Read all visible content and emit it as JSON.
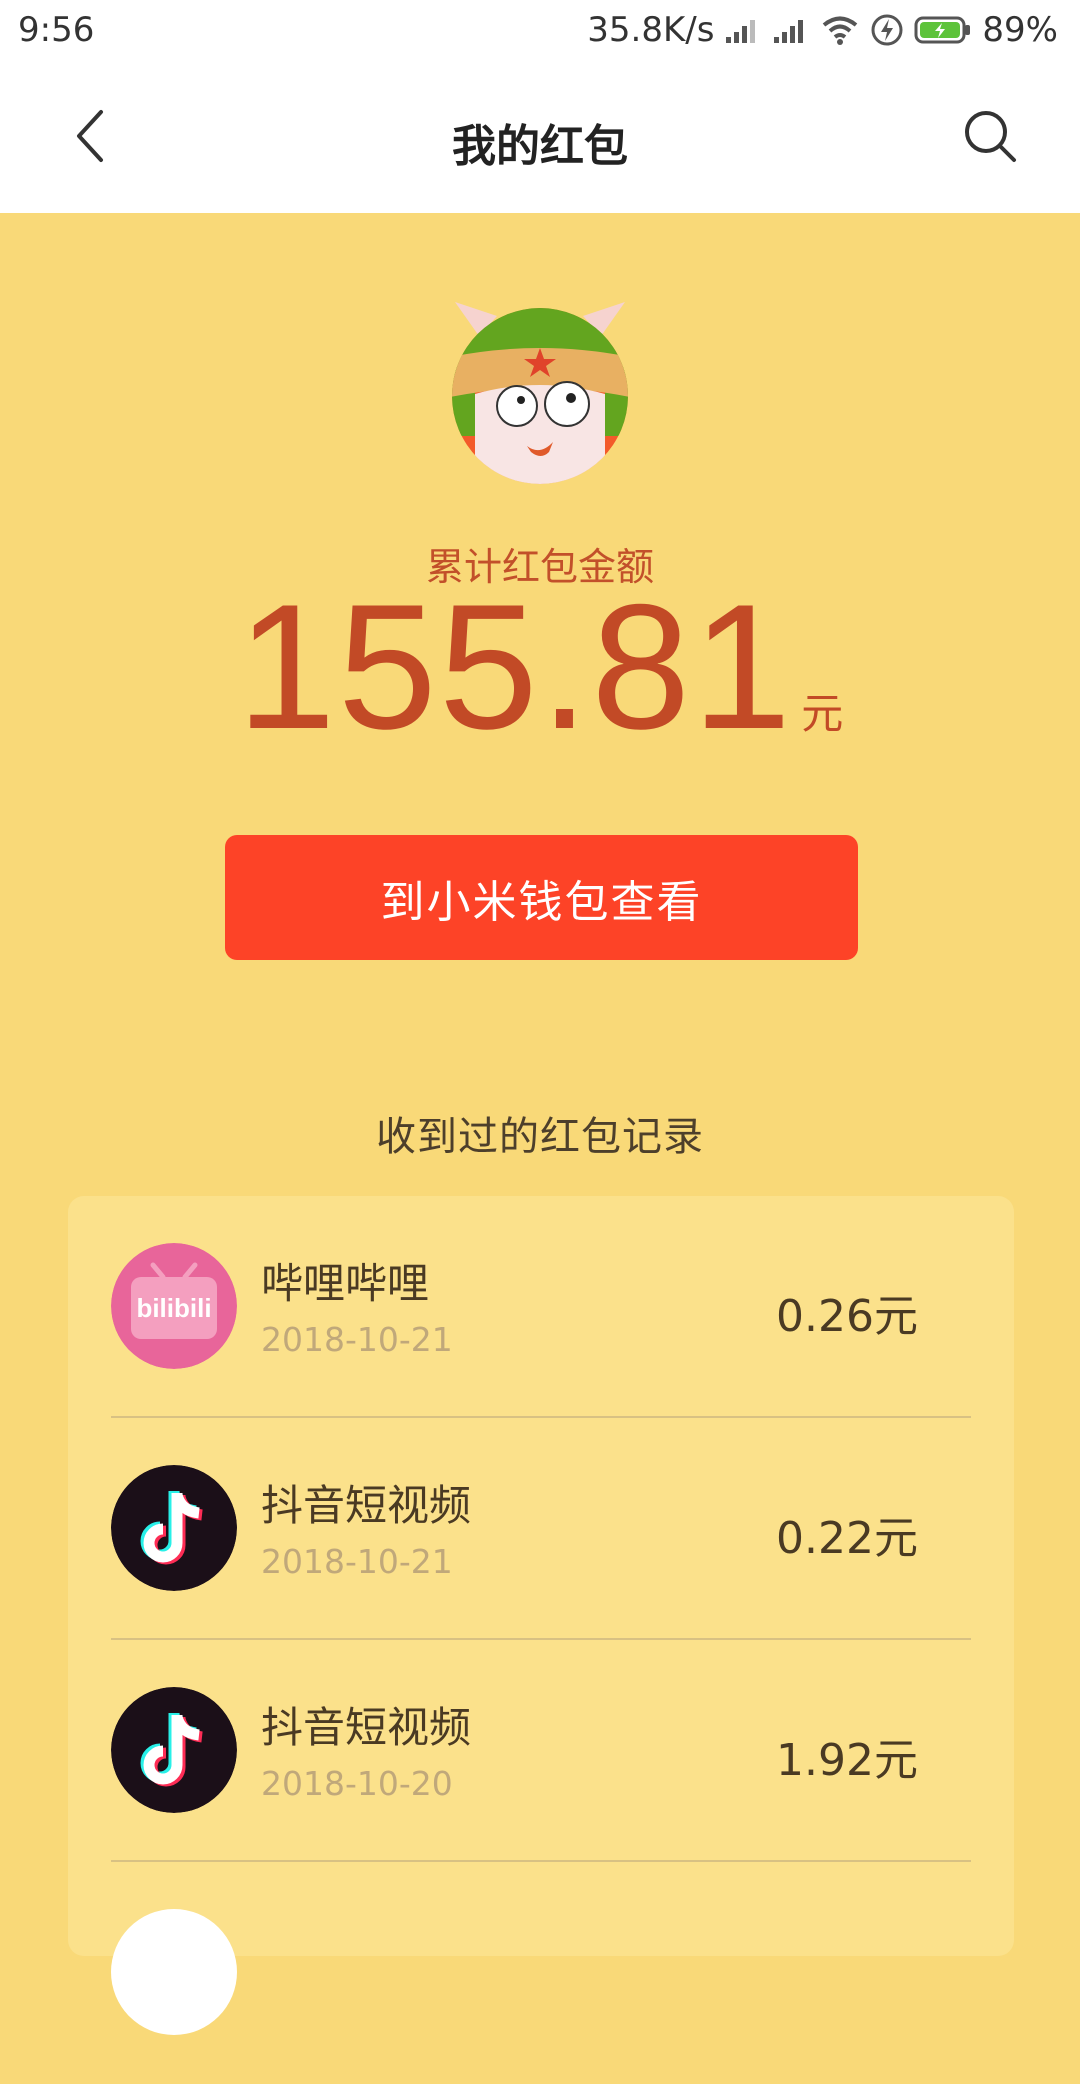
{
  "status_bar": {
    "time": "9:56",
    "network_speed": "35.8K/s",
    "battery": "89%",
    "icons": [
      "signal-icon",
      "signal-icon",
      "wifi-icon",
      "charging-icon",
      "battery-icon"
    ]
  },
  "header": {
    "title": "我的红包",
    "back_icon": "chevron-left-icon",
    "search_icon": "search-icon"
  },
  "summary": {
    "label": "累计红包金额",
    "amount": "155.81",
    "unit": "元"
  },
  "wallet_button": {
    "label": "到小米钱包查看"
  },
  "records": {
    "title": "收到过的红包记录",
    "items": [
      {
        "name": "哔哩哔哩",
        "date": "2018-10-21",
        "amount": "0.26元",
        "icon": "bilibili-icon"
      },
      {
        "name": "抖音短视频",
        "date": "2018-10-21",
        "amount": "0.22元",
        "icon": "douyin-icon"
      },
      {
        "name": "抖音短视频",
        "date": "2018-10-20",
        "amount": "1.92元",
        "icon": "douyin-icon"
      }
    ]
  },
  "colors": {
    "background": "#f9d978",
    "card": "#fbe18b",
    "accent_red": "#fd4327",
    "amount_text": "#c24a26"
  }
}
